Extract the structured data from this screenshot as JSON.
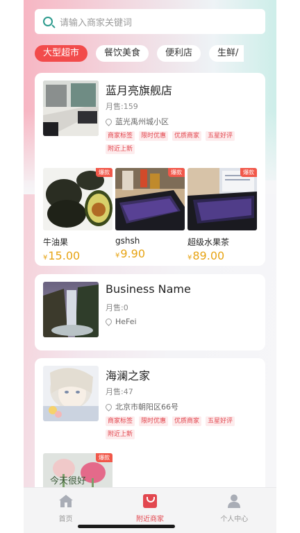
{
  "search": {
    "placeholder": "请输入商家关键词"
  },
  "tabs": [
    {
      "label": "大型超市",
      "active": true
    },
    {
      "label": "餐饮美食",
      "active": false
    },
    {
      "label": "便利店",
      "active": false
    },
    {
      "label": "生鲜/",
      "active": false
    }
  ],
  "stores": [
    {
      "name": "蓝月亮旗舰店",
      "sales": "月售:159",
      "address": "蓝光禹州城小区",
      "tags": [
        "商家标签",
        "限时优惠",
        "优质商家",
        "五星好评",
        "附近上新"
      ],
      "goods": [
        {
          "badge": "爆款",
          "name": "牛油果",
          "currency": "¥",
          "price": "15.00"
        },
        {
          "badge": "爆款",
          "name": "gshsh",
          "currency": "¥",
          "price": "9.90"
        },
        {
          "badge": "爆款",
          "name": "超级水果茶",
          "currency": "¥",
          "price": "89.00"
        }
      ]
    },
    {
      "name": "Business Name",
      "sales": "月售:0",
      "address": "HeFei",
      "tags": [],
      "goods": []
    },
    {
      "name": "海澜之家",
      "sales": "月售:47",
      "address": "北京市朝阳区66号",
      "tags": [
        "商家标签",
        "限时优惠",
        "优质商家",
        "五星好评",
        "附近上新"
      ],
      "goods": [
        {
          "badge": "爆款",
          "image_text": "今天很好"
        }
      ]
    }
  ],
  "tabbar": [
    {
      "label": "首页",
      "icon": "home-icon",
      "active": false
    },
    {
      "label": "附近商家",
      "icon": "shopping-bag-icon",
      "active": true
    },
    {
      "label": "个人中心",
      "icon": "user-icon",
      "active": false
    }
  ],
  "colors": {
    "accent": "#e2474f",
    "active_tab": "#f24b4b",
    "price": "#e7a414",
    "search_icon": "#2a9a8c"
  }
}
